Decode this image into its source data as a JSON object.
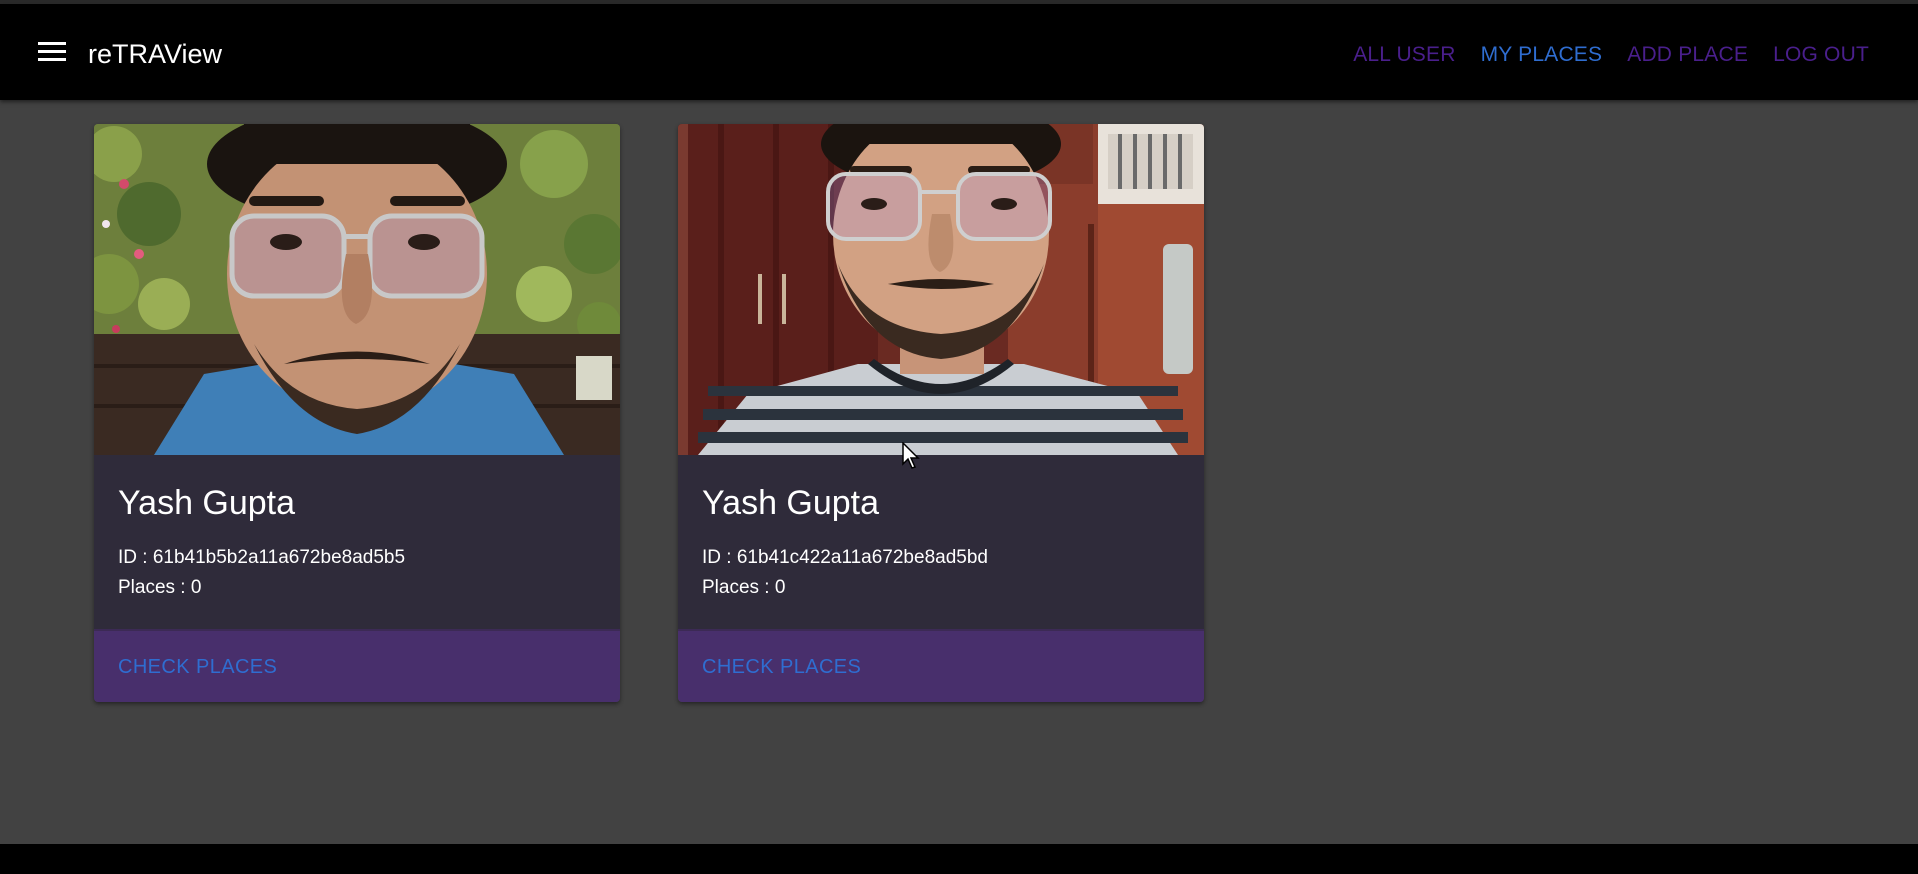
{
  "app": {
    "title": "reTRAView"
  },
  "nav": {
    "all_user": "ALL USER",
    "my_places": "MY PLACES",
    "add_place": "ADD PLACE",
    "log_out": "LOG OUT"
  },
  "users": [
    {
      "name": "Yash Gupta",
      "id_text": "ID : 61b41b5b2a11a672be8ad5b5",
      "places_text": "Places : 0",
      "action": "CHECK PLACES"
    },
    {
      "name": "Yash Gupta",
      "id_text": "ID : 61b41c422a11a672be8ad5bd",
      "places_text": "Places : 0",
      "action": "CHECK PLACES"
    }
  ],
  "colors": {
    "appbar": "#000000",
    "background": "#424242",
    "card_body": "#2f2b3a",
    "card_actions": "#482f6c",
    "link_blue": "#2f6dd0",
    "link_purple": "#4a1f8c"
  },
  "icons": {
    "menu": "hamburger-menu-icon",
    "cursor": "mouse-pointer-icon"
  }
}
